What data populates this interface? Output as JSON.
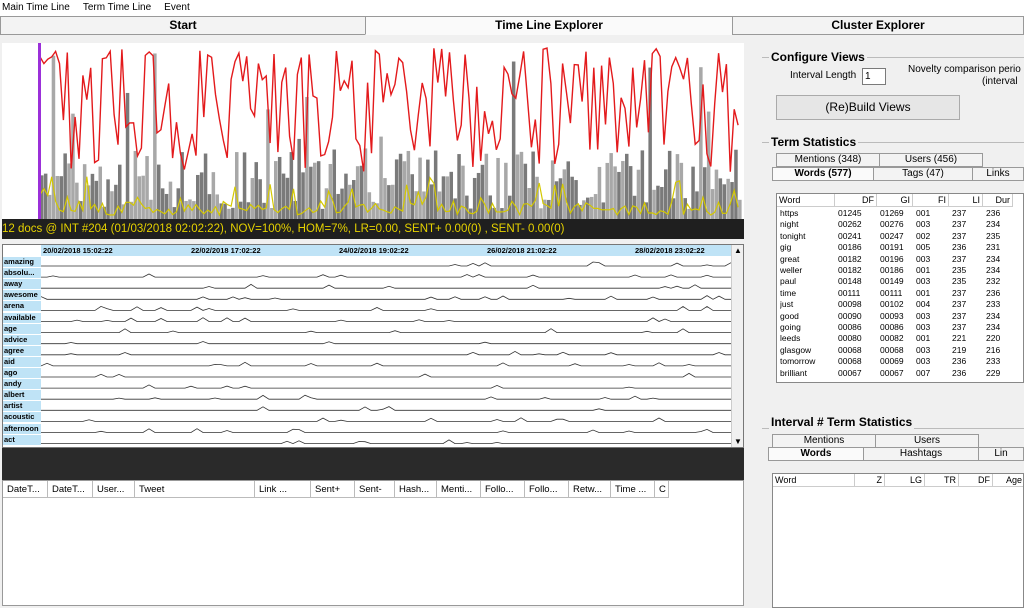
{
  "menu": [
    "Main Time Line",
    "Term Time Line",
    "Event"
  ],
  "tabs": [
    "Start",
    "Time Line Explorer",
    "Cluster Explorer"
  ],
  "active_tab": "Time Line Explorer",
  "status_text": "12 docs @ INT #204 (01/03/2018 02:02:22), NOV=100%, HOM=7%, LR=0.00, SENT+ 0.00(0) , SENT- 0.00(0)",
  "timeline": {
    "date_labels": [
      "20/02/2018 15:02:22",
      "22/02/2018 17:02:22",
      "24/02/2018 19:02:22",
      "26/02/2018 21:02:22",
      "28/02/2018 23:02:22"
    ],
    "terms": [
      "amazing",
      "absolu...",
      "away",
      "awesome",
      "arena",
      "available",
      "age",
      "advice",
      "agree",
      "aid",
      "ago",
      "andy",
      "albert",
      "artist",
      "acoustic",
      "afternoon",
      "act"
    ]
  },
  "tweet_table": {
    "columns": [
      "DateT...",
      "DateT...",
      "User...",
      "Tweet",
      "Link ...",
      "Sent+",
      "Sent-",
      "Hash...",
      "Menti...",
      "Follo...",
      "Follo...",
      "Retw...",
      "Time ...",
      "C"
    ]
  },
  "configure": {
    "title": "Configure Views",
    "interval_label": "Interval Length",
    "interval_value": "1",
    "novelty_label": "Novelty comparison perio",
    "novelty_label2": "(interval",
    "build_button": "(Re)Build Views"
  },
  "term_stats": {
    "title": "Term Statistics",
    "tabs_top": [
      "Mentions (348)",
      "Users (456)"
    ],
    "tabs_bottom": [
      "Words (577)",
      "Tags (47)",
      "Links"
    ],
    "active": "Words (577)",
    "columns": [
      "Word",
      "DF",
      "GI",
      "FI",
      "LI",
      "Dur"
    ],
    "rows": [
      [
        "https",
        "01245",
        "01269",
        "001",
        "237",
        "236"
      ],
      [
        "night",
        "00262",
        "00276",
        "003",
        "237",
        "234"
      ],
      [
        "tonight",
        "00241",
        "00247",
        "002",
        "237",
        "235"
      ],
      [
        "gig",
        "00186",
        "00191",
        "005",
        "236",
        "231"
      ],
      [
        "great",
        "00182",
        "00196",
        "003",
        "237",
        "234"
      ],
      [
        "weller",
        "00182",
        "00186",
        "001",
        "235",
        "234"
      ],
      [
        "paul",
        "00148",
        "00149",
        "003",
        "235",
        "232"
      ],
      [
        "time",
        "00111",
        "00111",
        "001",
        "237",
        "236"
      ],
      [
        "just",
        "00098",
        "00102",
        "004",
        "237",
        "233"
      ],
      [
        "good",
        "00090",
        "00093",
        "003",
        "237",
        "234"
      ],
      [
        "going",
        "00086",
        "00086",
        "003",
        "237",
        "234"
      ],
      [
        "leeds",
        "00080",
        "00082",
        "001",
        "221",
        "220"
      ],
      [
        "glasgow",
        "00068",
        "00068",
        "003",
        "219",
        "216"
      ],
      [
        "tomorrow",
        "00068",
        "00069",
        "003",
        "236",
        "233"
      ],
      [
        "brilliant",
        "00067",
        "00067",
        "007",
        "236",
        "229"
      ]
    ]
  },
  "interval_stats": {
    "title": "Interval # Term Statistics",
    "tabs_top": [
      "Mentions",
      "Users"
    ],
    "tabs_bottom": [
      "Words",
      "Hashtags",
      "Lin"
    ],
    "active": "Words",
    "columns": [
      "Word",
      "Z",
      "LG",
      "TR",
      "DF",
      "Age"
    ]
  },
  "colors": {
    "novelty_line": "#e31a1c",
    "sentiment_line": "#d4c800",
    "volume_bars": "#808080",
    "date_header": "#bfe3f6",
    "cursor": "#9b30d9"
  }
}
